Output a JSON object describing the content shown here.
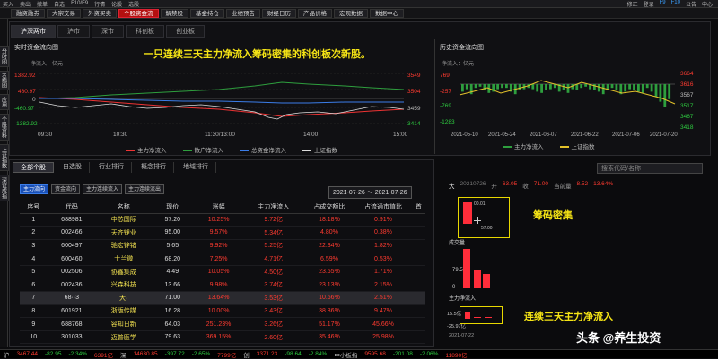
{
  "topbar": {
    "items": [
      "买入",
      "卖出",
      "撤单",
      "自选",
      "F10/F9",
      "行情",
      "论股",
      "选股"
    ],
    "right": [
      "修正",
      "登录",
      "F9",
      "F10",
      "公告",
      "中心"
    ]
  },
  "menubar": {
    "items": [
      "融资融券",
      "大宗交易",
      "外资买卖",
      "个股资金流",
      "解禁股",
      "基金持仓",
      "业绩预告",
      "财经日历",
      "产品价格",
      "宏观数据",
      "数据中心"
    ],
    "active": "个股资金流"
  },
  "leftstrip": [
    "分时图",
    "K线图",
    "应用",
    "个股资料",
    "上证指数",
    "深证成指"
  ],
  "market_tabs": [
    "沪深两市",
    "沪市",
    "深市",
    "科创板",
    "创业板"
  ],
  "market_tab_active": "沪深两市",
  "realtime": {
    "title": "实时资金流向图",
    "unit": "净流入：亿元",
    "overlay": "一只连续三天主力净流入筹码密集的科创板次新股。",
    "yleft": [
      "1382.92",
      "460.97",
      "0",
      "-460.97",
      "-1382.92"
    ],
    "yright": [
      "3549",
      "3504",
      "3459",
      "3414"
    ],
    "xticks": [
      "09:30",
      "10:30",
      "11:30/13:00",
      "14:00",
      "15:00"
    ],
    "legend": [
      "主力净流入",
      "散户净流入",
      "总资金净流入",
      "上证指数"
    ]
  },
  "history": {
    "title": "历史资金流向图",
    "unit": "净流入：亿元",
    "yleft": [
      "769",
      "-257",
      "-1283",
      "-769",
      "-1283"
    ],
    "yright": [
      "3664",
      "3616",
      "3567",
      "3517",
      "3467",
      "3418"
    ],
    "xticks": [
      "2021-05-10",
      "2021-05-24",
      "2021-06-07",
      "2021-06-22",
      "2021-07-06",
      "2021-07-20"
    ],
    "legend": [
      "主力净流入",
      "上证指数"
    ]
  },
  "subtabs": [
    "全部个股",
    "自选股",
    "行业排行",
    "概念排行",
    "地域排行"
  ],
  "search_placeholder": "搜索代码/名称",
  "filter_buttons": [
    "主力流向",
    "资金流向",
    "主力连续流入",
    "主力连续流出"
  ],
  "date_range": "2021-07-26 ～ 2021-07-26",
  "table": {
    "headers": [
      "序号",
      "代码",
      "名称",
      "现价",
      "涨幅",
      "主力净流入",
      "占成交额比",
      "占流通市值比",
      "首"
    ],
    "rows": [
      [
        "1",
        "688981",
        "中芯国际",
        "57.20",
        "10.25%",
        "9.72亿",
        "18.18%",
        "0.91%"
      ],
      [
        "2",
        "002466",
        "天齐锂业",
        "95.00",
        "9.57%",
        "5.34亿",
        "4.80%",
        "0.38%"
      ],
      [
        "3",
        "600497",
        "驰宏锌锗",
        "5.65",
        "9.92%",
        "5.25亿",
        "22.34%",
        "1.82%"
      ],
      [
        "4",
        "600460",
        "士兰微",
        "68.20",
        "7.25%",
        "4.71亿",
        "6.59%",
        "0.53%"
      ],
      [
        "5",
        "002506",
        "协鑫集成",
        "4.49",
        "10.05%",
        "4.50亿",
        "23.65%",
        "1.71%"
      ],
      [
        "6",
        "002436",
        "兴森科技",
        "13.66",
        "9.98%",
        "3.74亿",
        "23.13%",
        "2.15%"
      ],
      [
        "7",
        "68··3",
        "大·",
        "71.00",
        "13.64%",
        "3.53亿",
        "10.66%",
        "2.51%"
      ],
      [
        "8",
        "601921",
        "浙版传媒",
        "16.28",
        "10.00%",
        "3.43亿",
        "38.86%",
        "9.47%"
      ],
      [
        "9",
        "688768",
        "容知日新",
        "64.03",
        "251.23%",
        "3.26亿",
        "51.17%",
        "45.66%"
      ],
      [
        "10",
        "301033",
        "迈普医学",
        "79.63",
        "369.15%",
        "2.60亿",
        "35.46%",
        "25.98%"
      ]
    ],
    "selected_row": 6
  },
  "right": {
    "stock_name": "大",
    "date": "20210726",
    "price_label": "开",
    "price_open": "63.05",
    "label_close": "收",
    "close": "71.00",
    "label_vol": "当前量",
    "vol": "8.52",
    "change_pct": "13.64%",
    "chip_label": "筹码密集",
    "chip_small1": "00.01",
    "chip_small2": "57.00",
    "vol_title": "成交量",
    "vol_val": "79.5万",
    "vol_zero": "0",
    "main_title": "主力净流入",
    "main_val1": "15.5亿",
    "main_val2": "-25.97亿",
    "main_date": "2021-07-22",
    "flow_label": "连续三天主力净流入"
  },
  "statusbar": [
    "沪",
    "3467.44",
    "-82.95",
    "-2.34%",
    "6391亿",
    "深",
    "14630.85",
    "-397.72",
    "-2.65%",
    "7799亿",
    "创",
    "3371.23",
    "-98.64",
    "-2.84%",
    "中小板指",
    "9595.68",
    "-201.08",
    "-2.06%",
    "11890亿"
  ],
  "watermark": "头条 @养生投资",
  "colors": {
    "accent_red": "#ff3b30",
    "overlay_yellow": "#f5e415",
    "up": "#ff3b30",
    "down": "#2ecc40"
  }
}
